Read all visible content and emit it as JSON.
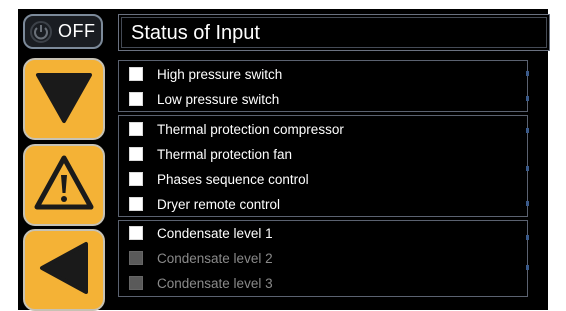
{
  "power": {
    "label": "OFF",
    "icon": "power-icon"
  },
  "side_buttons": [
    {
      "icon": "arrow-down-icon",
      "color": "#f4b236"
    },
    {
      "icon": "warning-icon",
      "color": "#f4b236"
    },
    {
      "icon": "arrow-left-icon",
      "color": "#f4b236"
    }
  ],
  "header": {
    "title": "Status of Input"
  },
  "groups": [
    {
      "items": [
        {
          "label": "High pressure switch",
          "active": true
        },
        {
          "label": "Low pressure switch",
          "active": true
        }
      ]
    },
    {
      "items": [
        {
          "label": "Thermal protection compressor",
          "active": true
        },
        {
          "label": "Thermal protection fan",
          "active": true
        },
        {
          "label": "Phases sequence control",
          "active": true
        },
        {
          "label": "Dryer remote control",
          "active": true
        }
      ]
    },
    {
      "items": [
        {
          "label": "Condensate level 1",
          "active": true
        },
        {
          "label": "Condensate level 2",
          "active": false
        },
        {
          "label": "Condensate level 3",
          "active": false
        }
      ]
    }
  ],
  "colors": {
    "accent": "#f4b236",
    "background": "#000000",
    "checkbox_on": "#ffffff",
    "checkbox_off": "#5a5a5a"
  }
}
